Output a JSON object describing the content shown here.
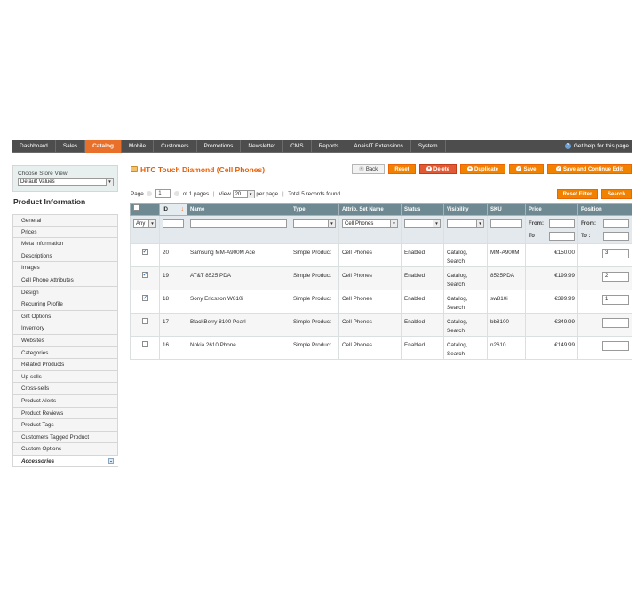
{
  "nav": {
    "items": [
      "Dashboard",
      "Sales",
      "Catalog",
      "Mobile",
      "Customers",
      "Promotions",
      "Newsletter",
      "CMS",
      "Reports",
      "AnaisIT Extensions",
      "System"
    ],
    "active": "Catalog",
    "help": "Get help for this page"
  },
  "sidebar": {
    "store_label": "Choose Store View:",
    "store_value": "Default Values",
    "title": "Product Information",
    "tabs": [
      "General",
      "Prices",
      "Meta Information",
      "Descriptions",
      "Images",
      "Cell Phone Attributes",
      "Design",
      "Recurring Profile",
      "Gift Options",
      "Inventory",
      "Websites",
      "Categories",
      "Related Products",
      "Up-sells",
      "Cross-sells",
      "Product Alerts",
      "Product Reviews",
      "Product Tags",
      "Customers Tagged Product",
      "Custom Options",
      "Accessories"
    ],
    "active_tab": "Accessories"
  },
  "header": {
    "title": "HTC Touch Diamond (Cell Phones)",
    "buttons": {
      "back": "Back",
      "reset": "Reset",
      "delete": "Delete",
      "duplicate": "Duplicate",
      "save": "Save",
      "save_continue": "Save and Continue Edit"
    }
  },
  "pager": {
    "page_label": "Page",
    "page_value": "1",
    "of_pages": "of 1 pages",
    "view_label": "View",
    "view_value": "20",
    "per_page": "per page",
    "records": "Total 5 records found",
    "reset_filter": "Reset Filter",
    "search": "Search"
  },
  "grid": {
    "columns": [
      "",
      "ID",
      "Name",
      "Type",
      "Attrib. Set Name",
      "Status",
      "Visibility",
      "SKU",
      "Price",
      "Position"
    ],
    "filter": {
      "select_any": "Any",
      "attrib_set": "Cell Phones",
      "from": "From:",
      "to": "To :"
    },
    "rows": [
      {
        "checked": true,
        "id": "20",
        "name": "Samsung MM-A900M Ace",
        "type": "Simple Product",
        "attrib": "Cell Phones",
        "status": "Enabled",
        "vis1": "Catalog,",
        "vis2": "Search",
        "sku": "MM-A900M",
        "price": "€150.00",
        "position": "3"
      },
      {
        "checked": true,
        "id": "19",
        "name": "AT&T 8525 PDA",
        "type": "Simple Product",
        "attrib": "Cell Phones",
        "status": "Enabled",
        "vis1": "Catalog,",
        "vis2": "Search",
        "sku": "8525PDA",
        "price": "€199.99",
        "position": "2"
      },
      {
        "checked": true,
        "id": "18",
        "name": "Sony Ericsson W810i",
        "type": "Simple Product",
        "attrib": "Cell Phones",
        "status": "Enabled",
        "vis1": "Catalog,",
        "vis2": "Search",
        "sku": "sw810i",
        "price": "€399.99",
        "position": "1"
      },
      {
        "checked": false,
        "id": "17",
        "name": "BlackBerry 8100 Pearl",
        "type": "Simple Product",
        "attrib": "Cell Phones",
        "status": "Enabled",
        "vis1": "Catalog,",
        "vis2": "Search",
        "sku": "bb8100",
        "price": "€349.99",
        "position": ""
      },
      {
        "checked": false,
        "id": "16",
        "name": "Nokia 2610 Phone",
        "type": "Simple Product",
        "attrib": "Cell Phones",
        "status": "Enabled",
        "vis1": "Catalog,",
        "vis2": "Search",
        "sku": "n2610",
        "price": "€149.99",
        "position": ""
      }
    ]
  }
}
